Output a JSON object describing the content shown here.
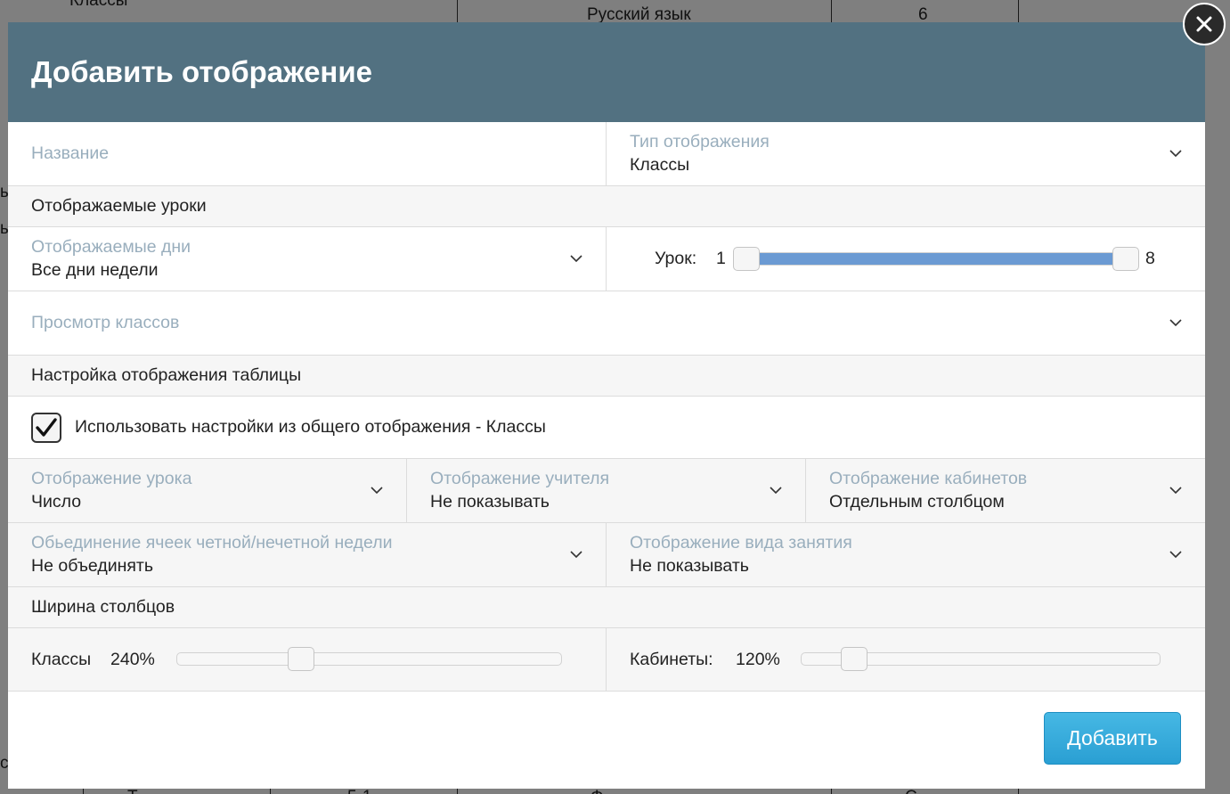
{
  "background": {
    "top_item": "Классы",
    "subject": "Русский язык",
    "count": "6",
    "left_fragment_1": "ы",
    "left_fragment_2": "ы",
    "left_fragment_3": "с",
    "bottom_fragment_1": "Т",
    "bottom_fragment_2": "5-1",
    "bottom_fragment_3": "Ф",
    "bottom_fragment_4": "С"
  },
  "modal": {
    "title": "Добавить отображение",
    "name_field": {
      "label": "Название",
      "value": ""
    },
    "display_type": {
      "label": "Тип отображения",
      "value": "Классы"
    },
    "section_lessons": "Отображаемые уроки",
    "days": {
      "label": "Отображаемые дни",
      "value": "Все дни недели"
    },
    "lesson_slider": {
      "label": "Урок:",
      "min_label": "1",
      "max_label": "8",
      "low": 1,
      "high": 8
    },
    "class_view": {
      "label": "Просмотр классов",
      "value": ""
    },
    "section_table": "Настройка отображения таблицы",
    "use_common": {
      "label": "Использовать настройки из общего отображения - Классы",
      "checked": true
    },
    "lesson_display": {
      "label": "Отображение урока",
      "value": "Число"
    },
    "teacher_display": {
      "label": "Отображение учителя",
      "value": "Не показывать"
    },
    "room_display": {
      "label": "Отображение кабинетов",
      "value": "Отдельным столбцом"
    },
    "merge_cells": {
      "label": "Обьединение ячеек четной/нечетной недели",
      "value": "Не объединять"
    },
    "activity_display": {
      "label": "Отображение вида занятия",
      "value": "Не показывать"
    },
    "section_width": "Ширина столбцов",
    "classes_width": {
      "label": "Классы",
      "value": "240%",
      "fraction": 0.31
    },
    "rooms_width": {
      "label": "Кабинеты:",
      "value": "120%",
      "fraction": 0.12
    },
    "add_button": "Добавить"
  },
  "icons": {
    "close": "close-icon",
    "chevron": "chevron-down-icon",
    "check": "check-icon"
  },
  "colors": {
    "header": "#527181",
    "accent": "#2a9fd3",
    "label": "#99aebd",
    "range": "#6b9ad3"
  }
}
